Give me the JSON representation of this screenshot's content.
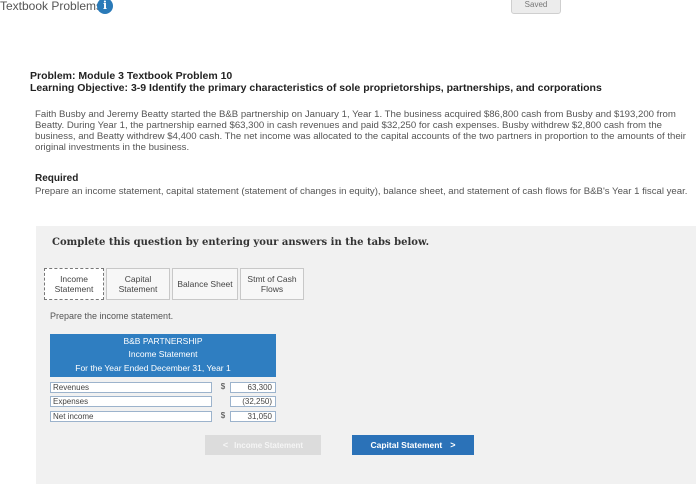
{
  "app": {
    "title": "Textbook Problems",
    "info_icon": "i",
    "saved": "Saved"
  },
  "problem": {
    "title": "Problem: Module 3 Textbook Problem 10",
    "objective": "Learning Objective: 3-9 Identify the primary characteristics of sole proprietorships, partnerships, and corporations",
    "paragraph": "Faith Busby and Jeremy Beatty started the B&B partnership on January 1, Year 1. The business acquired $86,800 cash from Busby and $193,200 from Beatty. During Year 1, the partnership earned $63,300 in cash revenues and paid $32,250 for cash expenses. Busby withdrew $2,800 cash from the business, and Beatty withdrew $4,400 cash. The net income was allocated to the capital accounts of the two partners in proportion to the amounts of their original investments in the business.",
    "required_title": "Required",
    "required_text": "Prepare an income statement, capital statement (statement of changes in equity), balance sheet, and statement of cash flows for B&B's Year 1 fiscal year."
  },
  "panel": {
    "heading": "Complete this question by entering your answers in the tabs below.",
    "tabs": [
      {
        "line1": "Income",
        "line2": "Statement"
      },
      {
        "line1": "Capital",
        "line2": "Statement"
      },
      {
        "line1": "Balance Sheet",
        "line2": ""
      },
      {
        "line1": "Stmt of Cash",
        "line2": "Flows"
      }
    ],
    "instruction": "Prepare the income statement."
  },
  "statement": {
    "company": "B&B PARTNERSHIP",
    "name": "Income Statement",
    "period": "For the Year Ended December 31, Year 1",
    "rows": [
      {
        "label": "Revenues",
        "currency": "$",
        "value": "63,300"
      },
      {
        "label": "Expenses",
        "currency": "",
        "value": "(32,250)"
      },
      {
        "label": "Net income",
        "currency": "$",
        "value": "31,050"
      }
    ]
  },
  "nav": {
    "prev_label": "Income Statement",
    "next_label": "Capital Statement"
  }
}
